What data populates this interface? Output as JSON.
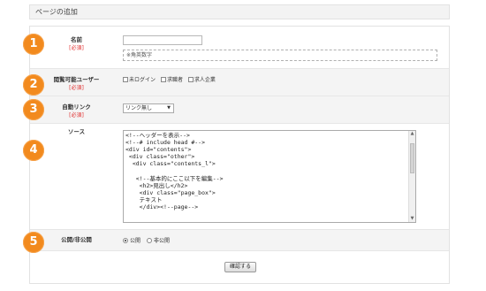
{
  "header": {
    "title": "ページの追加"
  },
  "steps": [
    "1",
    "2",
    "3",
    "4",
    "5"
  ],
  "fields": {
    "name": {
      "label": "名前",
      "required": "[必須]",
      "value": "",
      "hint": "※角英数字"
    },
    "viewer": {
      "label": "閲覧可能ユーザー",
      "required": "[必須]",
      "options": [
        "未ログイン",
        "求職者",
        "求人企業"
      ]
    },
    "autolink": {
      "label": "自動リンク",
      "required": "[必須]",
      "selected": "リンク無し"
    },
    "source": {
      "label": "ソース",
      "lines": [
        "<!--ヘッダーを表示-->",
        "<!--# include head #-->",
        "<div id=\"contents\">",
        " <div class=\"other\">",
        "  <div class=\"contents_l\">",
        "",
        "   <!--基本的にここ以下を編集-->",
        "    <h2>見出し</h2>",
        "    <div class=\"page_box\">",
        "    テキスト",
        "    </div><!--page-->"
      ]
    },
    "publish": {
      "label": "公開/非公開",
      "options": [
        "公開",
        "非公開"
      ],
      "selected": "公開"
    }
  },
  "confirm_button": "確認する",
  "colors": {
    "badge": "#f28a1e",
    "required": "#e03030"
  }
}
